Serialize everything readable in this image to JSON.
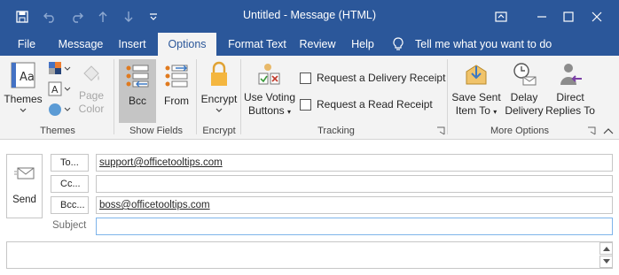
{
  "window": {
    "title": "Untitled  -  Message (HTML)"
  },
  "quick_access": [
    "save-icon",
    "undo-icon",
    "redo-icon",
    "up-arrow-icon",
    "down-arrow-icon",
    "customize-icon"
  ],
  "tabs": [
    {
      "label": "File"
    },
    {
      "label": "Message"
    },
    {
      "label": "Insert"
    },
    {
      "label": "Options",
      "active": true
    },
    {
      "label": "Format Text"
    },
    {
      "label": "Review"
    },
    {
      "label": "Help"
    }
  ],
  "tell_me": "Tell me what you want to do",
  "ribbon": {
    "themes_group": {
      "label": "Themes",
      "themes_button": "Themes",
      "page_color": [
        "Page",
        "Color"
      ]
    },
    "show_fields_group": {
      "label": "Show Fields",
      "bcc": "Bcc",
      "from": "From"
    },
    "encrypt_group": {
      "label": "Encrypt",
      "encrypt": "Encrypt"
    },
    "tracking_group": {
      "label": "Tracking",
      "voting": [
        "Use Voting",
        "Buttons"
      ],
      "delivery_receipt": "Request a Delivery Receipt",
      "read_receipt": "Request a Read Receipt"
    },
    "more_options_group": {
      "label": "More Options",
      "save_sent": [
        "Save Sent",
        "Item To"
      ],
      "delay": [
        "Delay",
        "Delivery"
      ],
      "direct": [
        "Direct",
        "Replies To"
      ]
    }
  },
  "compose": {
    "send": "Send",
    "to_label": "To...",
    "cc_label": "Cc...",
    "bcc_label": "Bcc...",
    "subject_label": "Subject",
    "to_value": "support@officetooltips.com",
    "cc_value": "",
    "bcc_value": "boss@officetooltips.com",
    "subject_value": ""
  },
  "colors": {
    "brand": "#2b579a",
    "ribbon_bg": "#f3f3f3",
    "focus_border": "#7eb4ea"
  }
}
